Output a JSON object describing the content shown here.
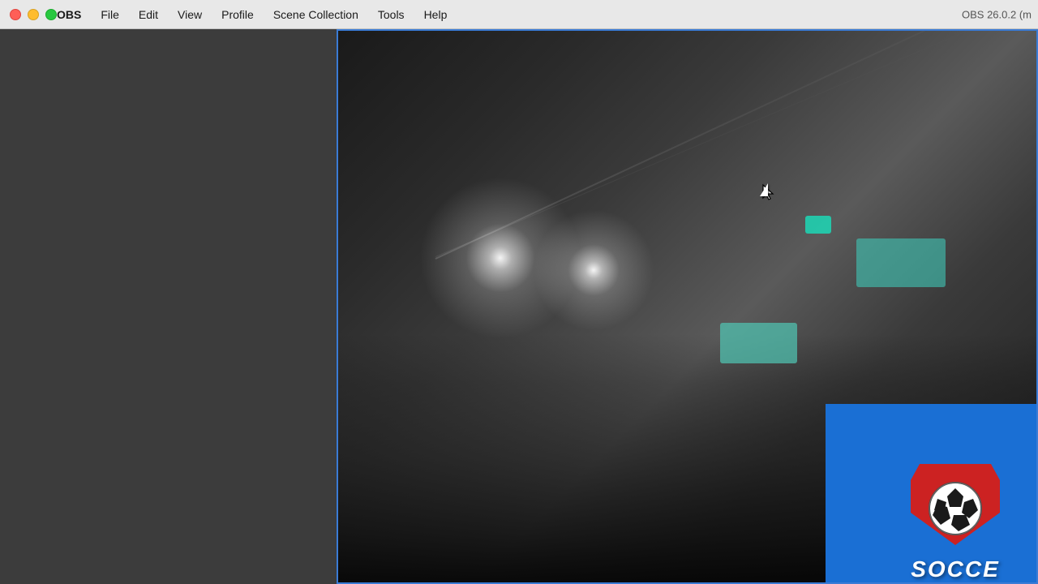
{
  "menubar": {
    "app_name": "OBS",
    "menu_items": [
      "OBS",
      "File",
      "Edit",
      "View",
      "Profile",
      "Scene Collection",
      "Tools",
      "Help"
    ],
    "version": "OBS 26.0.2 (m"
  },
  "traffic_lights": {
    "close_label": "close",
    "minimize_label": "minimize",
    "maximize_label": "maximize"
  },
  "preview": {
    "border_color": "#3a7bd5"
  }
}
